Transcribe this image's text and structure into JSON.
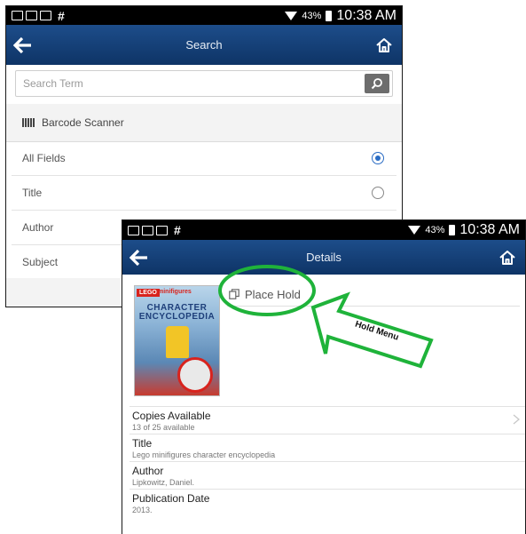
{
  "search_screen": {
    "status": {
      "battery_pct": "43%",
      "time": "10:38 AM",
      "hash": "#"
    },
    "appbar": {
      "title": "Search"
    },
    "search": {
      "placeholder": "Search Term"
    },
    "barcode": {
      "label": "Barcode Scanner"
    },
    "fields": [
      {
        "label": "All Fields",
        "selected": true
      },
      {
        "label": "Title",
        "selected": false
      },
      {
        "label": "Author",
        "selected": false
      },
      {
        "label": "Subject",
        "selected": false
      }
    ]
  },
  "details_screen": {
    "status": {
      "battery_pct": "43%",
      "time": "10:38 AM",
      "hash": "#"
    },
    "appbar": {
      "title": "Details"
    },
    "cover": {
      "logo": "LEGO",
      "logo2": "minifigures",
      "title": "CHARACTER ENCYCLOPEDIA"
    },
    "hold": {
      "label": "Place Hold"
    },
    "rows": [
      {
        "label": "Copies Available",
        "value": "13 of 25 available"
      },
      {
        "label": "Title",
        "value": "Lego minifigures character encyclopedia"
      },
      {
        "label": "Author",
        "value": "Lipkowitz, Daniel."
      },
      {
        "label": "Publication Date",
        "value": "2013."
      }
    ]
  },
  "annotation": {
    "label": "Hold Menu"
  },
  "colors": {
    "appbar": "#12407a",
    "annotation_green": "#1fb33a",
    "radio_selected": "#2a6cc4"
  },
  "icons": {
    "back": "arrow-left-icon",
    "home": "home-icon",
    "search": "magnifier-icon",
    "barcode": "barcode-icon",
    "hold": "place-hold-icon",
    "chevron": "chevron-right-icon"
  }
}
